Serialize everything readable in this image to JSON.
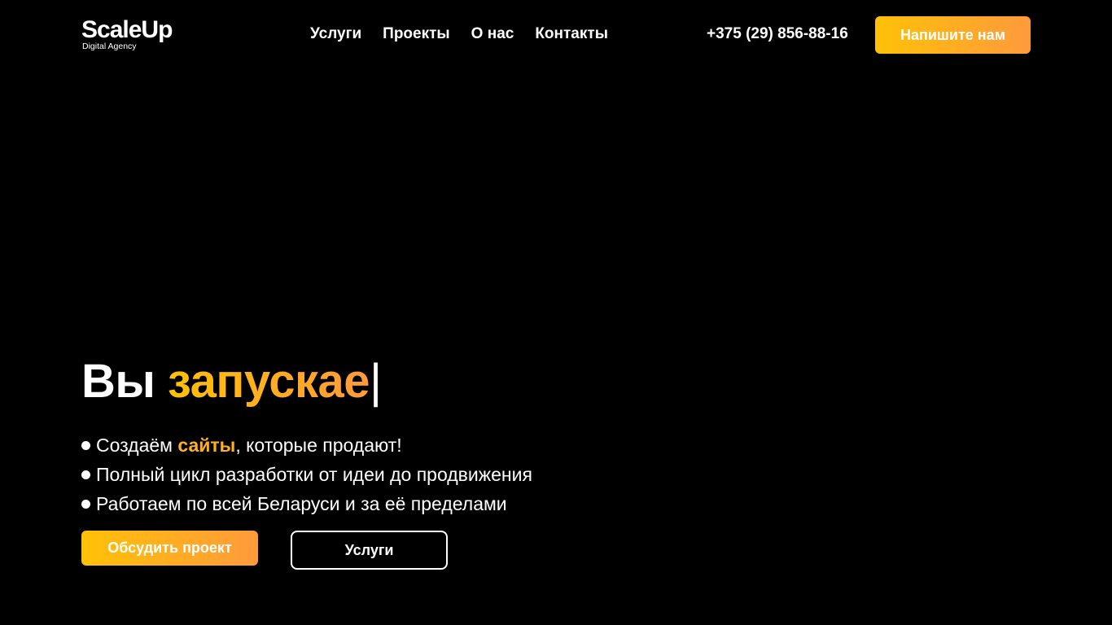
{
  "brand": {
    "name": "ScaleUp",
    "tagline": "Digital Agency"
  },
  "nav": {
    "items": [
      {
        "label": "Услуги"
      },
      {
        "label": "Проекты"
      },
      {
        "label": "О нас"
      },
      {
        "label": "Контакты"
      }
    ]
  },
  "header": {
    "phone": "+375 (29) 856-88-16",
    "cta_label": "Напишите нам"
  },
  "hero": {
    "title_prefix": "Вы ",
    "title_typed": "запускае",
    "cursor": "|",
    "bullets": [
      {
        "before": "Создаём ",
        "highlight": "сайты",
        "after": ", которые продают!"
      },
      {
        "before": "Полный цикл разработки от идеи до продвижения",
        "highlight": "",
        "after": ""
      },
      {
        "before": "Работаем по всей Беларуси и за её пределами",
        "highlight": "",
        "after": ""
      }
    ],
    "primary_button": "Обсудить проект",
    "secondary_button": "Услуги"
  },
  "colors": {
    "background": "#000000",
    "text": "#ffffff",
    "accent_start": "#FFC107",
    "accent_end": "#FF9A3C",
    "highlight": "#FFB020"
  }
}
